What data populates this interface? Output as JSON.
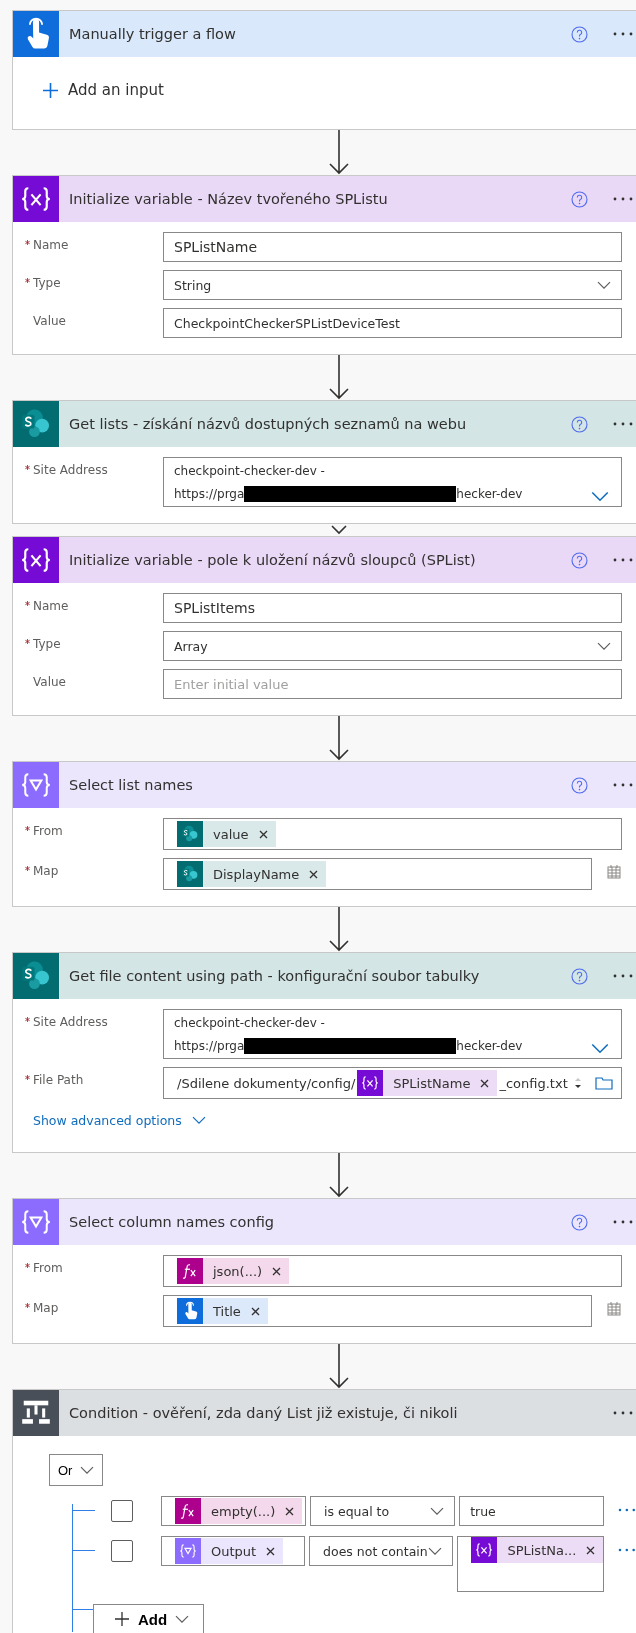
{
  "cards": [
    {
      "kind": "trigger",
      "title": "Manually trigger a flow",
      "help": true,
      "add_input": "Add an input"
    },
    {
      "kind": "variable",
      "connector": {
        "kind": "long"
      },
      "title": "Initialize variable - Název tvořeného SPListu",
      "help": true,
      "fields": [
        {
          "kind": "text",
          "label": "Name",
          "required": true,
          "value": "SPListName"
        },
        {
          "kind": "dropdown",
          "label": "Type",
          "required": true,
          "value": "String"
        },
        {
          "kind": "text",
          "label": "Value",
          "required": false,
          "value": "CheckpointCheckerSPListDeviceTest"
        }
      ]
    },
    {
      "kind": "sharepoint",
      "connector": {
        "kind": "long"
      },
      "title": "Get lists - získání názvů dostupných seznamů na webu",
      "help": true,
      "fields": [
        {
          "kind": "site",
          "label": "Site Address",
          "required": true,
          "line1": "checkpoint-checker-dev -",
          "url_start": "https://prga",
          "url_end": "hecker-dev"
        }
      ]
    },
    {
      "kind": "variable",
      "connector": {
        "kind": "short"
      },
      "title": "Initialize variable - pole k uložení názvů sloupců (SPList)",
      "help": true,
      "fields": [
        {
          "kind": "text",
          "label": "Name",
          "required": true,
          "value": "SPListItems"
        },
        {
          "kind": "dropdown",
          "label": "Type",
          "required": true,
          "value": "Array"
        },
        {
          "kind": "text",
          "label": "Value",
          "required": false,
          "placeholder": "Enter initial value"
        }
      ]
    },
    {
      "kind": "select",
      "connector": {
        "kind": "long"
      },
      "title": "Select list names",
      "help": true,
      "fields": [
        {
          "kind": "tokens",
          "label": "From",
          "required": true,
          "tokens": [
            {
              "kind": "sharepoint",
              "label": "value"
            }
          ]
        },
        {
          "kind": "map",
          "label": "Map",
          "required": true,
          "tokens": [
            {
              "kind": "sharepoint",
              "label": "DisplayName"
            }
          ]
        }
      ]
    },
    {
      "kind": "sharepoint",
      "connector": {
        "kind": "long"
      },
      "title": "Get file content using path - konfigurační soubor tabulky",
      "help": true,
      "fields": [
        {
          "kind": "site",
          "label": "Site Address",
          "required": true,
          "line1": "checkpoint-checker-dev -",
          "url_start": "https://prga",
          "url_end": "hecker-dev"
        },
        {
          "kind": "path",
          "label": "File Path",
          "required": true,
          "parts": [
            {
              "kind": "text",
              "text": "/Sdilene dokumenty/config/"
            },
            {
              "kind": "variable",
              "label": "SPListName"
            },
            {
              "kind": "text",
              "text": "_config.txt"
            }
          ]
        }
      ],
      "advanced": "Show advanced options"
    },
    {
      "kind": "select",
      "connector": {
        "kind": "long"
      },
      "title": "Select column names config",
      "help": true,
      "fields": [
        {
          "kind": "tokens",
          "label": "From",
          "required": true,
          "tokens": [
            {
              "kind": "expression",
              "label": "json(...)"
            }
          ]
        },
        {
          "kind": "map",
          "label": "Map",
          "required": true,
          "tokens": [
            {
              "kind": "trigger",
              "label": "Title"
            }
          ]
        }
      ]
    },
    {
      "kind": "condition",
      "connector": {
        "kind": "long"
      },
      "title": "Condition - ověření, zda daný List již existuje, či nikoli",
      "help": false,
      "condition": {
        "operator": "Or",
        "add": "Add",
        "rows": [
          {
            "checked": false,
            "left": {
              "kind": "expression",
              "label": "empty(...)"
            },
            "op": "is equal to",
            "right": {
              "kind": "text",
              "text": "true"
            }
          },
          {
            "checked": false,
            "left": {
              "kind": "select",
              "label": "Output"
            },
            "op": "does not contain",
            "right": {
              "kind": "variable",
              "label": "SPListNa..."
            }
          }
        ]
      }
    }
  ]
}
